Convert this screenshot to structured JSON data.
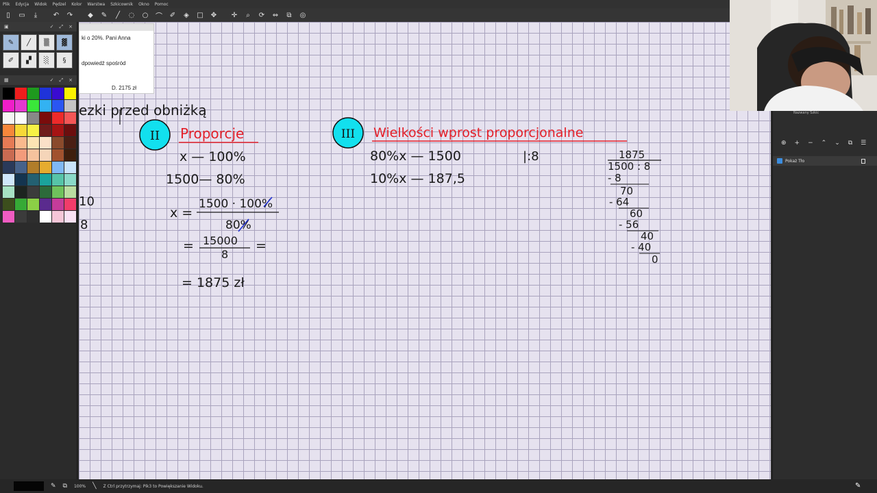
{
  "menu": [
    "Plik",
    "Edycja",
    "Widok",
    "Pędzel",
    "Kolor",
    "Warstwa",
    "Szkicownik",
    "Okno",
    "Pomoc"
  ],
  "dock": {
    "x": "×"
  },
  "palette": [
    "#000000",
    "#ef1d1d",
    "#1e9a1e",
    "#1f33d9",
    "#3a0bd0",
    "#fbf200",
    "#f01ec9",
    "#e43ad0",
    "#3ae63a",
    "#33b2f2",
    "#2a56f2",
    "#c4c4c4",
    "#f4f4f4",
    "#fbfbfb",
    "#888888",
    "#7a0c0c",
    "#ee2a2a",
    "#f45656",
    "#f6873b",
    "#f7d838",
    "#f7f245",
    "#6f1b1b",
    "#a61414",
    "#6b0e0e",
    "#e57b55",
    "#f9b98d",
    "#fde4b3",
    "#fbe0c8",
    "#8a4a2c",
    "#4a1f14",
    "#c96b52",
    "#f39b7b",
    "#f6c29d",
    "#f5d5b9",
    "#a1522e",
    "#3e1e0c",
    "#2a3a5a",
    "#46628a",
    "#b17d2a",
    "#e6ac2f",
    "#7fb8f4",
    "#c9e3fb",
    "#cfe7fb",
    "#14344f",
    "#236071",
    "#1ba39b",
    "#56c4a8",
    "#8ad9c8",
    "#a7e2c4",
    "#1d2420",
    "#3b3b3b",
    "#2c6b3a",
    "#6fc25c",
    "#b9dca0",
    "#3c4e1d",
    "#36aa36",
    "#8bd046",
    "#5a2b8e",
    "#c53c9a",
    "#f23c6a",
    "#f15cc2",
    "#3b3b3b",
    "#2e2e2e",
    "#ffffff",
    "#f6c6d8",
    "#fae1f5"
  ],
  "reference": {
    "line1": "ki o  20%. Pani Anna",
    "line2": "dpowiedź spośród",
    "line3": "D.   2175 zł"
  },
  "layer": {
    "name": "Pokaż Tło",
    "thumb": "Nazwany Szkic"
  },
  "status": {
    "text": "Z Ctrl przytrzymaj: Pik3 to Powiększanie Widoku.",
    "zoom": "100%"
  },
  "canvas": {
    "heading_fragment": "ezki  przed  obniżką",
    "badge2": "II",
    "title2": "Proporcje",
    "p_row1": "x  —  100%",
    "p_row2": "1500—  80%",
    "p_frac_eq": "x =",
    "p_frac_num": "1500 · 100%",
    "p_frac_den": "80%",
    "p_eq2_l": "=",
    "p_frac2_num": "15000",
    "p_frac2_den": "8",
    "p_eq2_r": "=",
    "p_result": "= 1875 zł",
    "badge3": "III",
    "title3": "Wielkości  wprost  proporcjonalne",
    "w_row1": "80%x  —  1500",
    "w_div": "|:8",
    "w_row2": "10%x  —  187,5",
    "ld_quot": "1875",
    "ld_div": "1500 : 8",
    "ld_s1": "- 8",
    "ld_r1": "70",
    "ld_s2": "- 64",
    "ld_r2": "60",
    "ld_s3": "- 56",
    "ld_r3": "40",
    "ld_s4": "- 40",
    "ld_r4": "0",
    "left_frag1": "10",
    "left_frag2": "8"
  }
}
